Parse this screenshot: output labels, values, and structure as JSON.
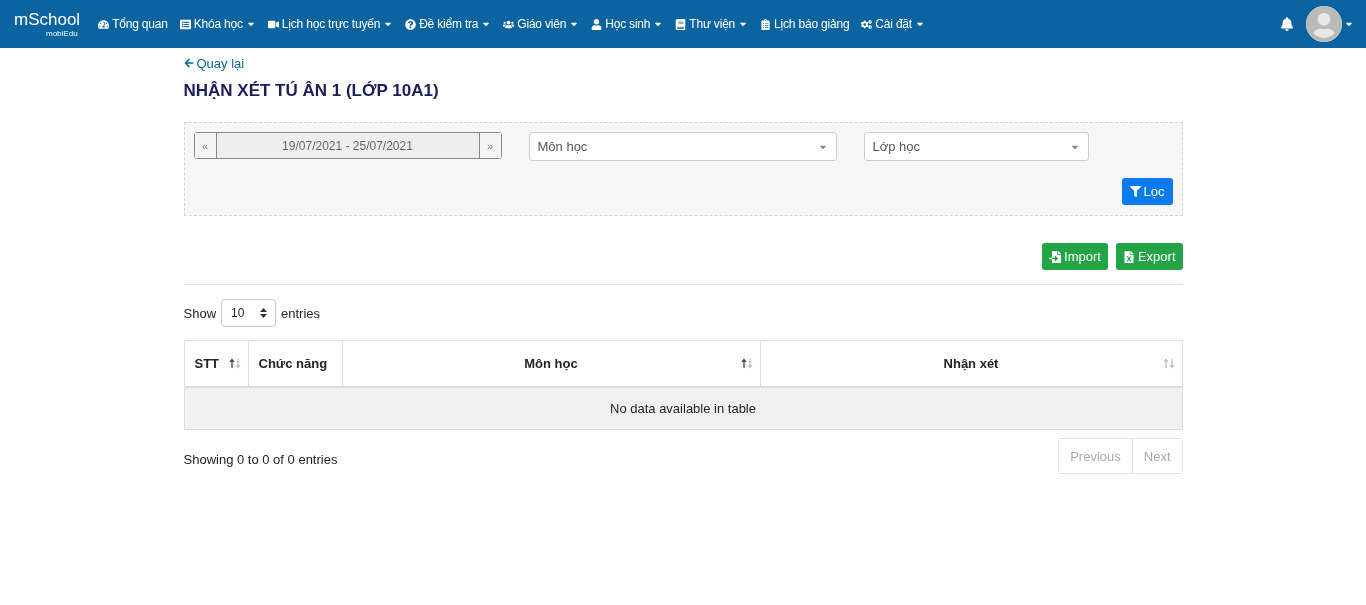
{
  "navbar": {
    "logo": "mSchool",
    "logo_sub": "mobiEdu",
    "items": [
      {
        "label": "Tổng quan",
        "dropdown": false
      },
      {
        "label": "Khóa học",
        "dropdown": true
      },
      {
        "label": "Lịch học trực tuyến",
        "dropdown": true
      },
      {
        "label": "Đề kiểm tra",
        "dropdown": true
      },
      {
        "label": "Giáo viên",
        "dropdown": true
      },
      {
        "label": "Học sinh",
        "dropdown": true
      },
      {
        "label": "Thư viện",
        "dropdown": true
      },
      {
        "label": "Lịch báo giảng",
        "dropdown": false
      },
      {
        "label": "Cài đặt",
        "dropdown": true
      }
    ]
  },
  "back_link": "Quay lại",
  "page_title": "NHẬN XÉT TÚ ÂN 1 (LỚP 10A1)",
  "filters": {
    "prev": "«",
    "date_range": "19/07/2021 - 25/07/2021",
    "next": "»",
    "subject": "Môn học",
    "class": "Lớp học",
    "filter_button": "Lọc"
  },
  "actions": [
    "Import",
    "Export"
  ],
  "length_menu": {
    "show": "Show",
    "value": "10",
    "entries": "entries"
  },
  "table": {
    "columns": [
      {
        "label": "STT",
        "sortable": true,
        "sorted": true
      },
      {
        "label": "Chức năng",
        "sortable": false
      },
      {
        "label": "Môn học",
        "sortable": true,
        "sorted": true
      },
      {
        "label": "Nhận xét",
        "sortable": true,
        "sorted": false
      }
    ],
    "empty": "No data available in table"
  },
  "info": "Showing 0 to 0 of 0 entries",
  "pagination": [
    {
      "label": "Previous",
      "disabled": true
    },
    {
      "label": "Next",
      "disabled": true
    }
  ]
}
